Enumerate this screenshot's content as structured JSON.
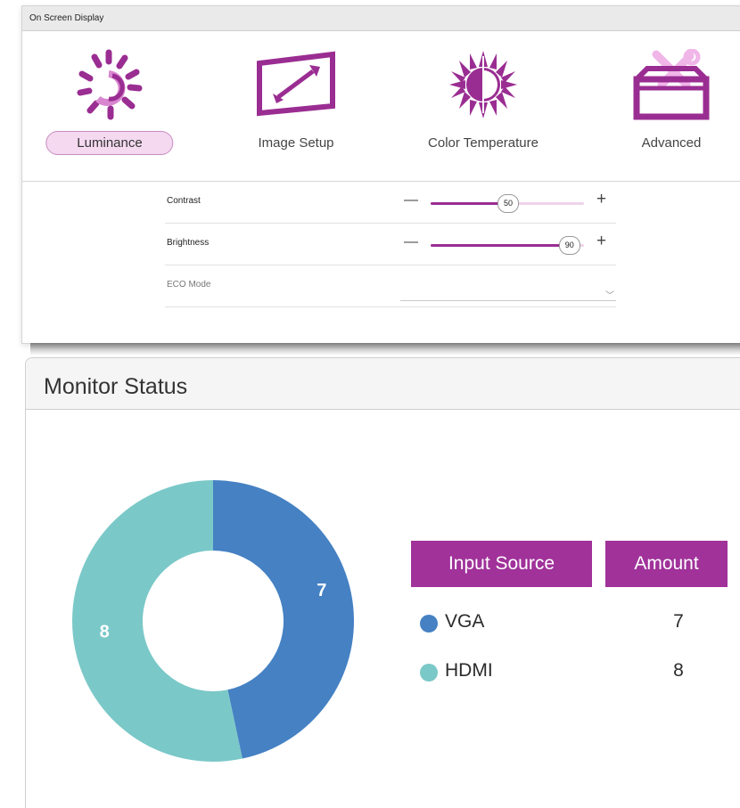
{
  "osd": {
    "title": "On Screen Display",
    "accent_color": "#9a2d92",
    "tabs": [
      {
        "label": "Luminance",
        "icon": "luminance-icon",
        "active": true
      },
      {
        "label": "Image Setup",
        "icon": "image-setup-icon",
        "active": false
      },
      {
        "label": "Color Temperature",
        "icon": "color-temperature-icon",
        "active": false
      },
      {
        "label": "Advanced",
        "icon": "advanced-toolbox-icon",
        "active": false
      }
    ],
    "settings": [
      {
        "label": "Contrast",
        "type": "slider",
        "value": "50",
        "fraction": 0.5
      },
      {
        "label": "Brightness",
        "type": "slider",
        "value": "90",
        "fraction": 0.9
      },
      {
        "label": "ECO Mode",
        "type": "dropdown",
        "value": "",
        "disabled": true
      }
    ]
  },
  "monitor_status": {
    "title": "Monitor Status",
    "legend": {
      "header_source": "Input Source",
      "header_amount": "Amount",
      "header_color": "#a0329a"
    }
  },
  "chart_data": {
    "type": "pie",
    "style": "donut",
    "categories": [
      "VGA",
      "HDMI"
    ],
    "values": [
      7,
      8
    ],
    "colors": [
      "#4581c3",
      "#7bc8c8"
    ],
    "data_labels": [
      "7",
      "8"
    ],
    "legend": "right"
  }
}
